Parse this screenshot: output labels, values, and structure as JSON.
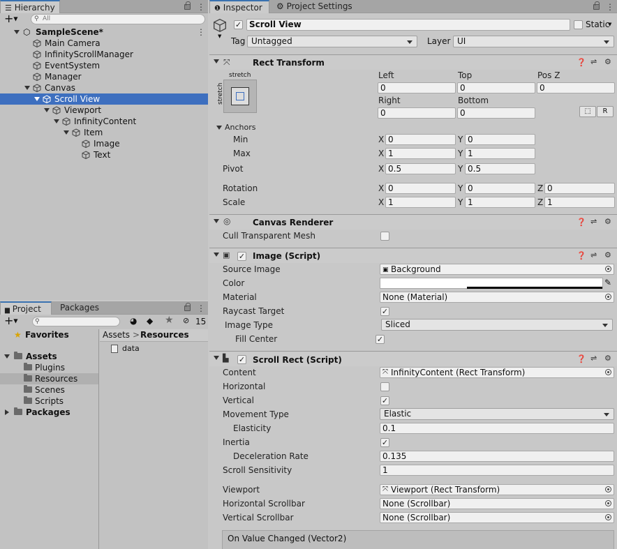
{
  "hierarchy": {
    "tab_label": "Hierarchy",
    "add_label": "+",
    "search_placeholder": "All",
    "items": [
      {
        "label": "SampleScene*"
      },
      {
        "label": "Main Camera"
      },
      {
        "label": "InfinityScrollManager"
      },
      {
        "label": "EventSystem"
      },
      {
        "label": "Manager"
      },
      {
        "label": "Canvas"
      },
      {
        "label": "Scroll View"
      },
      {
        "label": "Viewport"
      },
      {
        "label": "InfinityContent"
      },
      {
        "label": "Item"
      },
      {
        "label": "Image"
      },
      {
        "label": "Text"
      }
    ]
  },
  "project": {
    "tab_project": "Project",
    "tab_packages": "Packages",
    "hidden_count": "15",
    "favorites": "Favorites",
    "assets": "Assets",
    "folders": [
      "Plugins",
      "Resources",
      "Scenes",
      "Scripts"
    ],
    "packages": "Packages",
    "breadcrumb_root": "Assets",
    "breadcrumb_sep": ">",
    "breadcrumb_current": "Resources",
    "files": [
      "data"
    ]
  },
  "inspector": {
    "tab_inspector": "Inspector",
    "tab_project_settings": "Project Settings",
    "object_name": "Scroll View",
    "static_label": "Static",
    "tag_label": "Tag",
    "tag_value": "Untagged",
    "layer_label": "Layer",
    "layer_value": "UI",
    "rect_transform": {
      "title": "Rect Transform",
      "anchor_preset_top": "stretch",
      "anchor_preset_side": "stretch",
      "left_label": "Left",
      "left": "0",
      "top_label": "Top",
      "top": "0",
      "posz_label": "Pos Z",
      "posz": "0",
      "right_label": "Right",
      "right": "0",
      "bottom_label": "Bottom",
      "bottom": "0",
      "r_button": "R",
      "anchors_label": "Anchors",
      "min_label": "Min",
      "min_x": "0",
      "min_y": "0",
      "max_label": "Max",
      "max_x": "1",
      "max_y": "1",
      "pivot_label": "Pivot",
      "pivot_x": "0.5",
      "pivot_y": "0.5",
      "rotation_label": "Rotation",
      "rot_x": "0",
      "rot_y": "0",
      "rot_z": "0",
      "scale_label": "Scale",
      "scale_x": "1",
      "scale_y": "1",
      "scale_z": "1",
      "x": "X",
      "y": "Y",
      "z": "Z"
    },
    "canvas_renderer": {
      "title": "Canvas Renderer",
      "cull_label": "Cull Transparent Mesh"
    },
    "image_script": {
      "title": "Image (Script)",
      "source_label": "Source Image",
      "source_value": "Background",
      "color_label": "Color",
      "material_label": "Material",
      "material_value": "None (Material)",
      "raycast_label": "Raycast Target",
      "type_label": "Image Type",
      "type_value": "Sliced",
      "fill_label": "Fill Center"
    },
    "scroll_rect": {
      "title": "Scroll Rect (Script)",
      "content_label": "Content",
      "content_value": "InfinityContent (Rect Transform)",
      "horizontal_label": "Horizontal",
      "vertical_label": "Vertical",
      "movement_label": "Movement Type",
      "movement_value": "Elastic",
      "elasticity_label": "Elasticity",
      "elasticity_value": "0.1",
      "inertia_label": "Inertia",
      "decel_label": "Deceleration Rate",
      "decel_value": "0.135",
      "sensitivity_label": "Scroll Sensitivity",
      "sensitivity_value": "1",
      "viewport_label": "Viewport",
      "viewport_value": "Viewport (Rect Transform)",
      "hscroll_label": "Horizontal Scrollbar",
      "hscroll_value": "None (Scrollbar)",
      "vscroll_label": "Vertical Scrollbar",
      "vscroll_value": "None (Scrollbar)",
      "event_label": "On Value Changed (Vector2)"
    }
  },
  "colors": {
    "selection": "#3d6fbf",
    "panel": "#c2c2c2"
  }
}
